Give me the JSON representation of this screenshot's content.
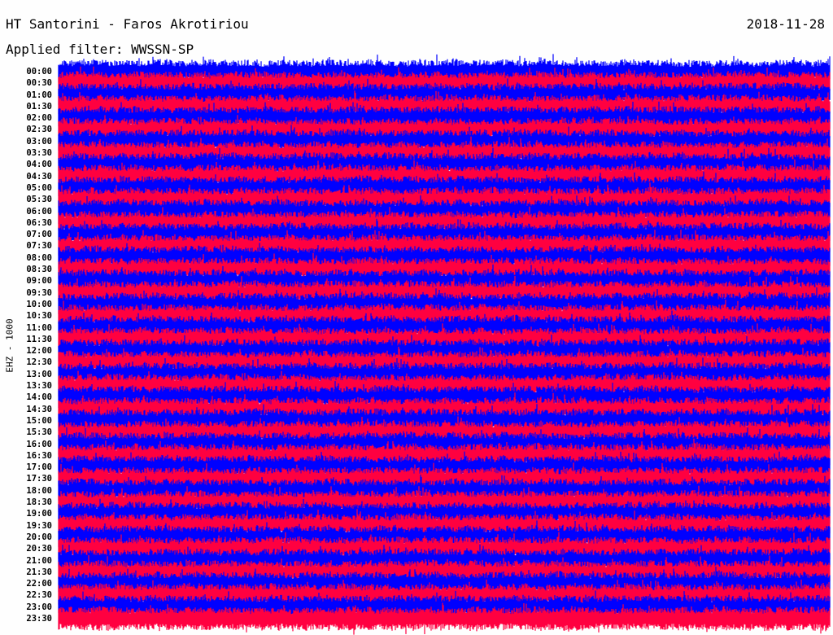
{
  "header": {
    "station": "HT Santorini - Faros Akrotiriou",
    "date": "2018-11-28",
    "filter": "Applied filter: WWSSN-SP"
  },
  "chart_data": {
    "type": "line",
    "title": "HT Santorini - Faros Akrotiriou",
    "ylabel": "EHZ - 1000",
    "xlabel": "",
    "row_labels": [
      "00:00",
      "00:30",
      "01:00",
      "01:30",
      "02:00",
      "02:30",
      "03:00",
      "03:30",
      "04:00",
      "04:30",
      "05:00",
      "05:30",
      "06:00",
      "06:30",
      "07:00",
      "07:30",
      "08:00",
      "08:30",
      "09:00",
      "09:30",
      "10:00",
      "10:30",
      "11:00",
      "11:30",
      "12:00",
      "12:30",
      "13:00",
      "13:30",
      "14:00",
      "14:30",
      "15:00",
      "15:30",
      "16:00",
      "16:30",
      "17:00",
      "17:30",
      "18:00",
      "18:30",
      "19:00",
      "19:30",
      "20:00",
      "20:30",
      "21:00",
      "21:30",
      "22:00",
      "22:30",
      "23:00",
      "23:30"
    ],
    "series_colors": [
      "#0000ff",
      "#ff0040"
    ],
    "grid": false
  }
}
